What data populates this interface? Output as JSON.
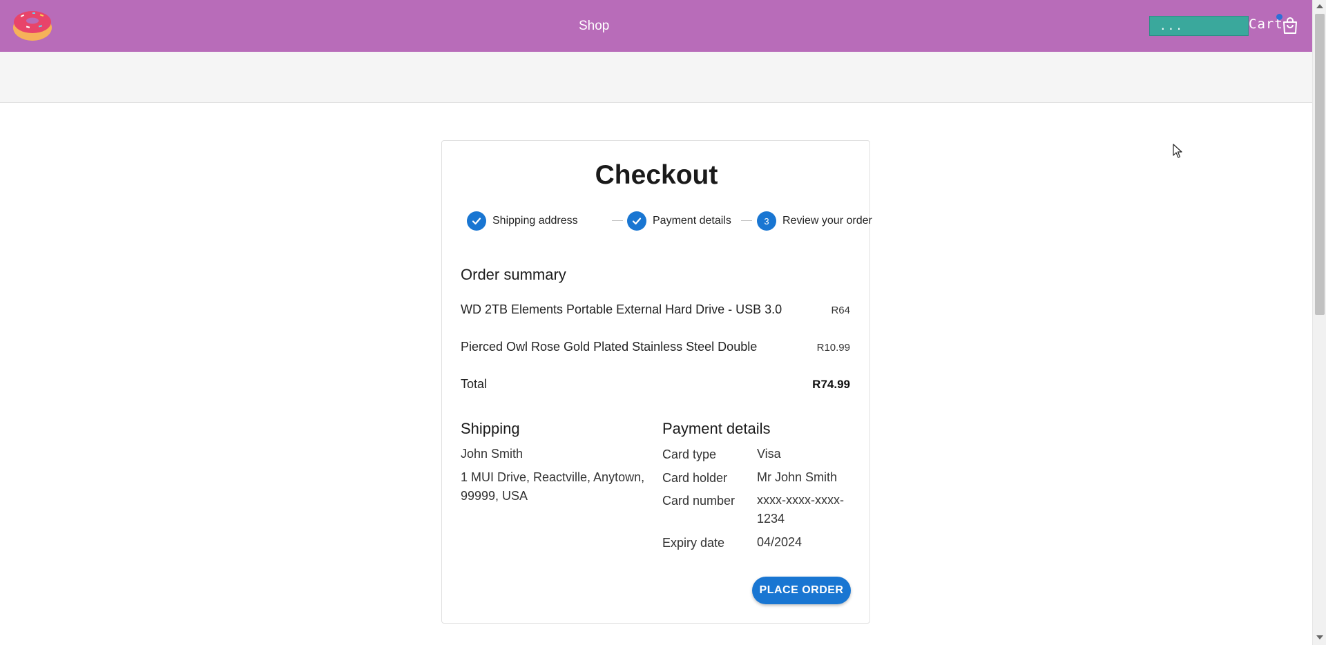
{
  "header": {
    "shop_label": "Shop",
    "search_value": "...",
    "cart_label": "Cart",
    "colors": {
      "bar": "#b86cb9",
      "search": "#3aa89c",
      "badge": "#2e6fd6"
    },
    "icons": {
      "logo": "donut-logo",
      "cart": "shopping-bag-icon"
    }
  },
  "checkout": {
    "title": "Checkout",
    "steps": [
      {
        "label": "Shipping address",
        "state": "completed",
        "icon": "check-icon"
      },
      {
        "label": "Payment details",
        "state": "completed",
        "icon": "check-icon"
      },
      {
        "label": "Review your order",
        "state": "active",
        "number": "3"
      }
    ],
    "order_summary": {
      "heading": "Order summary",
      "items": [
        {
          "name": "WD 2TB Elements Portable External Hard Drive - USB 3.0",
          "price": "R64"
        },
        {
          "name": "Pierced Owl Rose Gold Plated Stainless Steel Double",
          "price": "R10.99"
        }
      ],
      "total_label": "Total",
      "total_value": "R74.99"
    },
    "shipping": {
      "heading": "Shipping",
      "name": "John Smith",
      "address": "1 MUI Drive, Reactville, Anytown, 99999, USA"
    },
    "payment": {
      "heading": "Payment details",
      "rows": [
        {
          "label": "Card type",
          "value": "Visa"
        },
        {
          "label": "Card holder",
          "value": "Mr John Smith"
        },
        {
          "label": "Card number",
          "value": "xxxx-xxxx-xxxx-1234"
        },
        {
          "label": "Expiry date",
          "value": "04/2024"
        }
      ]
    },
    "place_order_label": "PLACE ORDER",
    "accent_color": "#1976d2"
  }
}
